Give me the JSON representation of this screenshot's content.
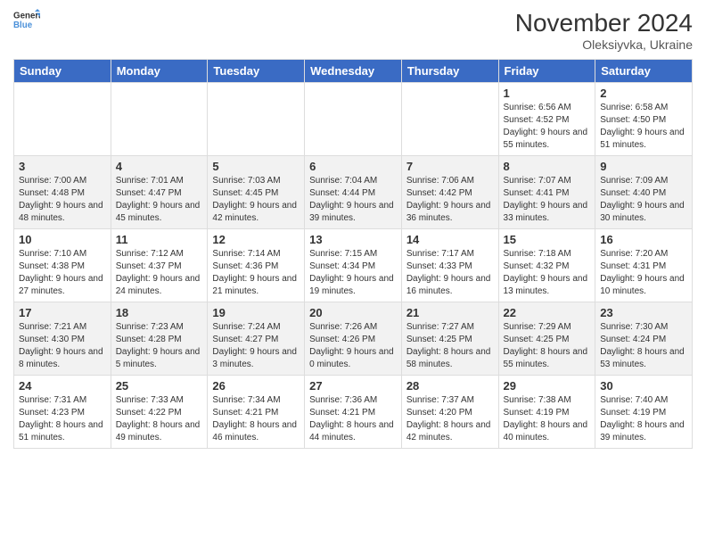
{
  "header": {
    "logo_general": "General",
    "logo_blue": "Blue",
    "month_title": "November 2024",
    "location": "Oleksiyvka, Ukraine"
  },
  "calendar": {
    "days_of_week": [
      "Sunday",
      "Monday",
      "Tuesday",
      "Wednesday",
      "Thursday",
      "Friday",
      "Saturday"
    ],
    "weeks": [
      [
        {
          "day": "",
          "info": ""
        },
        {
          "day": "",
          "info": ""
        },
        {
          "day": "",
          "info": ""
        },
        {
          "day": "",
          "info": ""
        },
        {
          "day": "",
          "info": ""
        },
        {
          "day": "1",
          "info": "Sunrise: 6:56 AM\nSunset: 4:52 PM\nDaylight: 9 hours and 55 minutes."
        },
        {
          "day": "2",
          "info": "Sunrise: 6:58 AM\nSunset: 4:50 PM\nDaylight: 9 hours and 51 minutes."
        }
      ],
      [
        {
          "day": "3",
          "info": "Sunrise: 7:00 AM\nSunset: 4:48 PM\nDaylight: 9 hours and 48 minutes."
        },
        {
          "day": "4",
          "info": "Sunrise: 7:01 AM\nSunset: 4:47 PM\nDaylight: 9 hours and 45 minutes."
        },
        {
          "day": "5",
          "info": "Sunrise: 7:03 AM\nSunset: 4:45 PM\nDaylight: 9 hours and 42 minutes."
        },
        {
          "day": "6",
          "info": "Sunrise: 7:04 AM\nSunset: 4:44 PM\nDaylight: 9 hours and 39 minutes."
        },
        {
          "day": "7",
          "info": "Sunrise: 7:06 AM\nSunset: 4:42 PM\nDaylight: 9 hours and 36 minutes."
        },
        {
          "day": "8",
          "info": "Sunrise: 7:07 AM\nSunset: 4:41 PM\nDaylight: 9 hours and 33 minutes."
        },
        {
          "day": "9",
          "info": "Sunrise: 7:09 AM\nSunset: 4:40 PM\nDaylight: 9 hours and 30 minutes."
        }
      ],
      [
        {
          "day": "10",
          "info": "Sunrise: 7:10 AM\nSunset: 4:38 PM\nDaylight: 9 hours and 27 minutes."
        },
        {
          "day": "11",
          "info": "Sunrise: 7:12 AM\nSunset: 4:37 PM\nDaylight: 9 hours and 24 minutes."
        },
        {
          "day": "12",
          "info": "Sunrise: 7:14 AM\nSunset: 4:36 PM\nDaylight: 9 hours and 21 minutes."
        },
        {
          "day": "13",
          "info": "Sunrise: 7:15 AM\nSunset: 4:34 PM\nDaylight: 9 hours and 19 minutes."
        },
        {
          "day": "14",
          "info": "Sunrise: 7:17 AM\nSunset: 4:33 PM\nDaylight: 9 hours and 16 minutes."
        },
        {
          "day": "15",
          "info": "Sunrise: 7:18 AM\nSunset: 4:32 PM\nDaylight: 9 hours and 13 minutes."
        },
        {
          "day": "16",
          "info": "Sunrise: 7:20 AM\nSunset: 4:31 PM\nDaylight: 9 hours and 10 minutes."
        }
      ],
      [
        {
          "day": "17",
          "info": "Sunrise: 7:21 AM\nSunset: 4:30 PM\nDaylight: 9 hours and 8 minutes."
        },
        {
          "day": "18",
          "info": "Sunrise: 7:23 AM\nSunset: 4:28 PM\nDaylight: 9 hours and 5 minutes."
        },
        {
          "day": "19",
          "info": "Sunrise: 7:24 AM\nSunset: 4:27 PM\nDaylight: 9 hours and 3 minutes."
        },
        {
          "day": "20",
          "info": "Sunrise: 7:26 AM\nSunset: 4:26 PM\nDaylight: 9 hours and 0 minutes."
        },
        {
          "day": "21",
          "info": "Sunrise: 7:27 AM\nSunset: 4:25 PM\nDaylight: 8 hours and 58 minutes."
        },
        {
          "day": "22",
          "info": "Sunrise: 7:29 AM\nSunset: 4:25 PM\nDaylight: 8 hours and 55 minutes."
        },
        {
          "day": "23",
          "info": "Sunrise: 7:30 AM\nSunset: 4:24 PM\nDaylight: 8 hours and 53 minutes."
        }
      ],
      [
        {
          "day": "24",
          "info": "Sunrise: 7:31 AM\nSunset: 4:23 PM\nDaylight: 8 hours and 51 minutes."
        },
        {
          "day": "25",
          "info": "Sunrise: 7:33 AM\nSunset: 4:22 PM\nDaylight: 8 hours and 49 minutes."
        },
        {
          "day": "26",
          "info": "Sunrise: 7:34 AM\nSunset: 4:21 PM\nDaylight: 8 hours and 46 minutes."
        },
        {
          "day": "27",
          "info": "Sunrise: 7:36 AM\nSunset: 4:21 PM\nDaylight: 8 hours and 44 minutes."
        },
        {
          "day": "28",
          "info": "Sunrise: 7:37 AM\nSunset: 4:20 PM\nDaylight: 8 hours and 42 minutes."
        },
        {
          "day": "29",
          "info": "Sunrise: 7:38 AM\nSunset: 4:19 PM\nDaylight: 8 hours and 40 minutes."
        },
        {
          "day": "30",
          "info": "Sunrise: 7:40 AM\nSunset: 4:19 PM\nDaylight: 8 hours and 39 minutes."
        }
      ]
    ]
  }
}
